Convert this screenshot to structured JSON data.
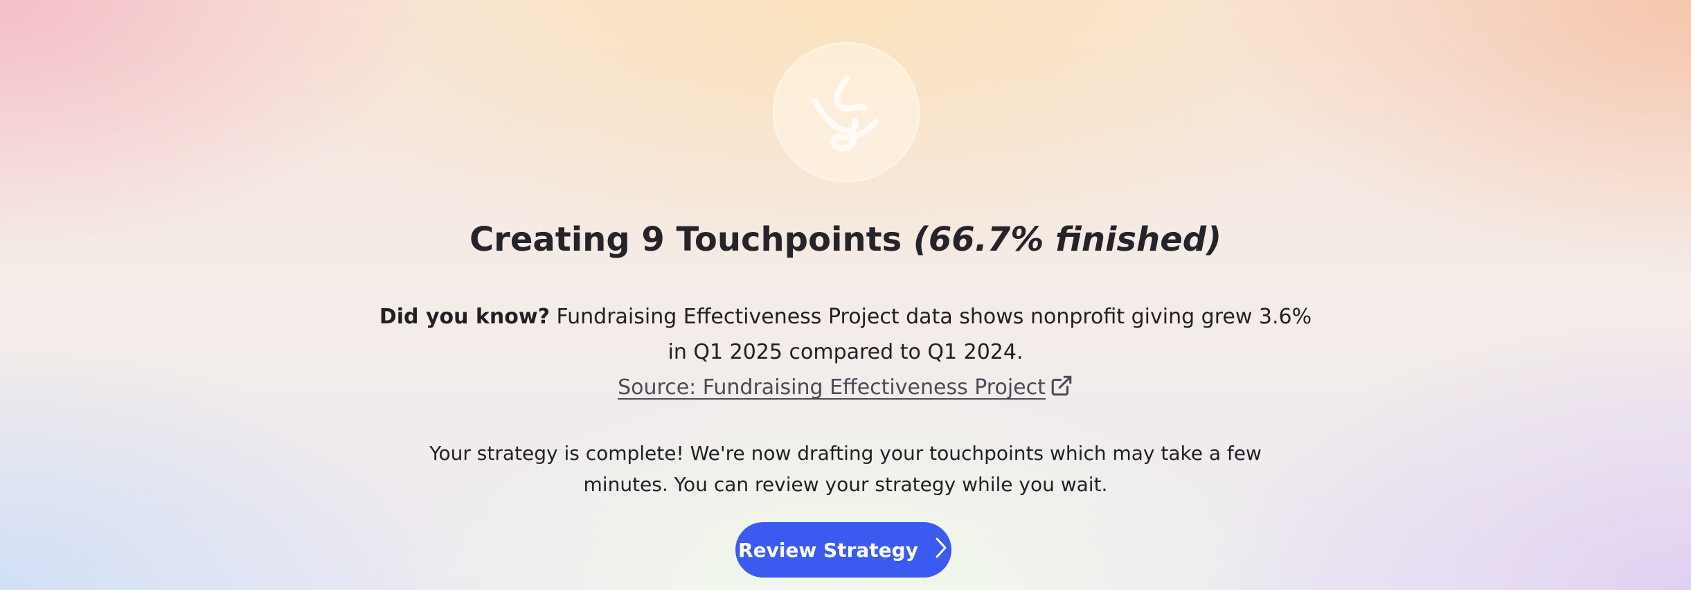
{
  "header": {
    "logo_icon": "swirl-logo-icon",
    "title_main": "Creating 9 Touchpoints",
    "title_progress": "(66.7% finished)",
    "progress_fraction": 0.667,
    "touchpoints_total": 9
  },
  "fact": {
    "lead": "Did you know?",
    "body": "Fundraising Effectiveness Project data shows nonprofit giving grew 3.6% in Q1 2025 compared to Q1 2024.",
    "source_label": "Source: Fundraising Effectiveness Project",
    "source_icon": "external-link-icon"
  },
  "status": {
    "message": "Your strategy is complete! We're now drafting your touchpoints which may take a few minutes. You can review your strategy while you wait."
  },
  "cta": {
    "label": "Review Strategy",
    "icon": "chevron-right-icon"
  },
  "colors": {
    "accent": "#3b5bf0",
    "text": "#1f1f24",
    "link": "#4a4a55"
  }
}
